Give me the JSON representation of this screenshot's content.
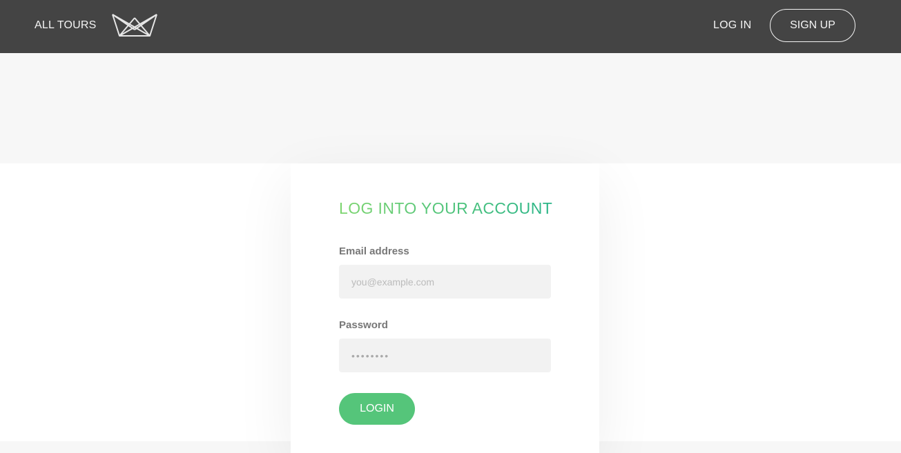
{
  "header": {
    "all_tours_label": "ALL TOURS",
    "logo_icon": "crown-logo-icon",
    "login_label": "LOG IN",
    "signup_label": "SIGN UP",
    "background_color": "#444444"
  },
  "login_form": {
    "title": "LOG INTO YOUR ACCOUNT",
    "title_gradient": [
      "#7dd56f",
      "#28b487"
    ],
    "email": {
      "label": "Email address",
      "placeholder": "you@example.com",
      "value": ""
    },
    "password": {
      "label": "Password",
      "value": "••••••••"
    },
    "submit_label": "LOGIN",
    "accent_color": "#55c57a"
  }
}
